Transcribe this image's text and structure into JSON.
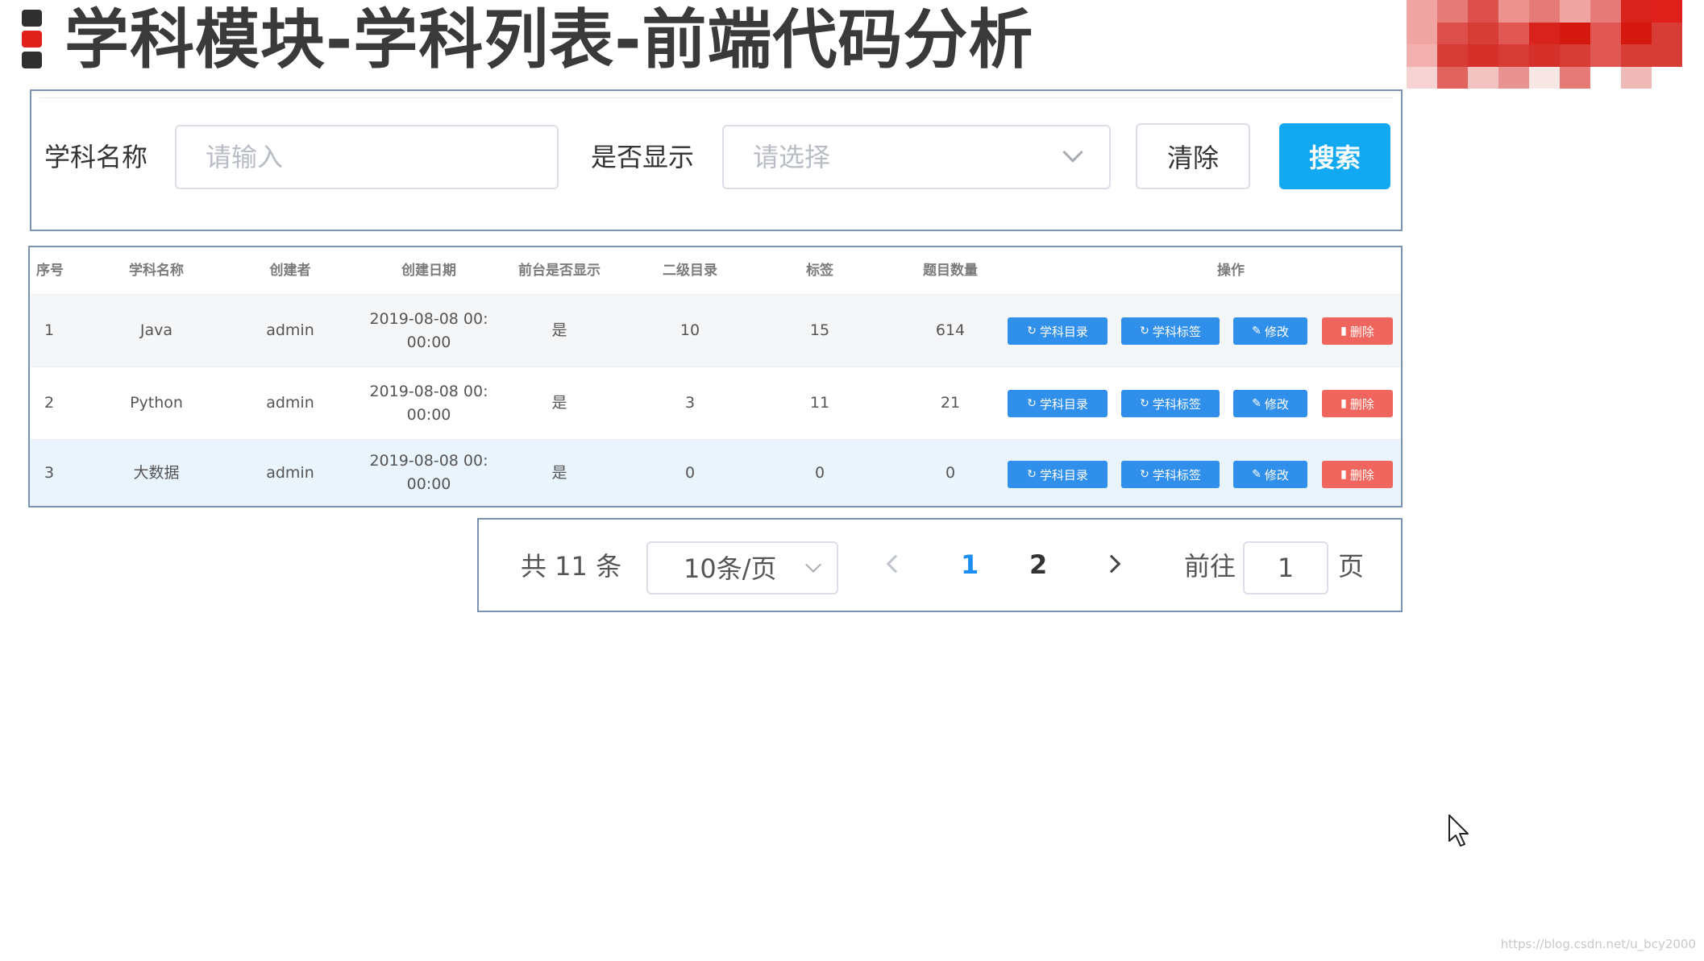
{
  "page": {
    "title": "学科模块-学科列表-前端代码分析"
  },
  "colors": {
    "title_red": "#e0201b",
    "primary": "#13a9f2",
    "op_primary": "#2f8fea",
    "op_danger": "#f0665e",
    "pager_active": "#1d8ff2"
  },
  "mosaic": [
    "#f0a5a3",
    "#e67a76",
    "#dc4f4a",
    "#ec938f",
    "#e67a76",
    "#f0a5a3",
    "#e67a76",
    "#d8221c",
    "#e0201b",
    "#f0a5a3",
    "#dc4f4a",
    "#d83c37",
    "#e05753",
    "#d8221c",
    "#d4170f",
    "#e05753",
    "#d4170f",
    "#d83c37",
    "#f2b1ae",
    "#d83c37",
    "#d42f28",
    "#d83c37",
    "#d42f28",
    "#d83c37",
    "#e05753",
    "#d83c37",
    "#d83c37",
    "#f6d3d2",
    "#e06360",
    "#f2c3c1",
    "#e89391",
    "#f8e6e5",
    "#e67a76",
    "#ffffff",
    "#efb9b7",
    "#ffffff",
    "#ffffff",
    "#ffffff",
    "#ffffff",
    "#ffffff",
    "#ffffff",
    "#ffffff",
    "#ffffff",
    "#ffffff",
    "#ffffff"
  ],
  "search": {
    "name_label": "学科名称",
    "name_placeholder": "请输入",
    "show_label": "是否显示",
    "show_placeholder": "请选择",
    "clear_label": "清除",
    "search_label": "搜索"
  },
  "table": {
    "headers": [
      "序号",
      "学科名称",
      "创建者",
      "创建日期",
      "前台是否显示",
      "二级目录",
      "标签",
      "题目数量",
      "操作"
    ],
    "rows": [
      {
        "index": "1",
        "name": "Java",
        "creator": "admin",
        "date": "2019-08-08 00:\n00:00",
        "show": "是",
        "dirs": "10",
        "tags": "15",
        "questions": "614"
      },
      {
        "index": "2",
        "name": "Python",
        "creator": "admin",
        "date": "2019-08-08 00:\n00:00",
        "show": "是",
        "dirs": "3",
        "tags": "11",
        "questions": "21"
      },
      {
        "index": "3",
        "name": "大数据",
        "creator": "admin",
        "date": "2019-08-08 00:\n00:00",
        "show": "是",
        "dirs": "0",
        "tags": "0",
        "questions": "0"
      }
    ],
    "actions": {
      "dir": "学科目录",
      "tag": "学科标签",
      "edit": "修改",
      "delete": "删除"
    }
  },
  "pager": {
    "total": "共 11 条",
    "page_size": "10条/页",
    "pages": [
      "1",
      "2"
    ],
    "goto_label": "前往",
    "goto_value": "1",
    "goto_unit": "页"
  },
  "watermark": "https://blog.csdn.net/u_bcy2000"
}
